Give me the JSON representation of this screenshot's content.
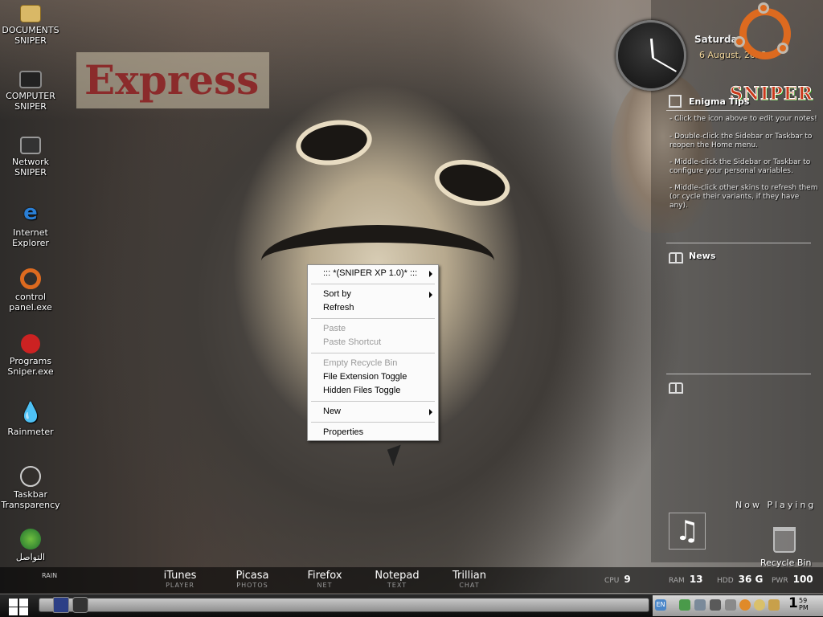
{
  "desktop_icons": [
    {
      "label": "DOCUMENTS SNIPER",
      "icon": "folder-icon"
    },
    {
      "label": "COMPUTER SNIPER",
      "icon": "computer-icon"
    },
    {
      "label": "Network SNIPER",
      "icon": "network-icon"
    },
    {
      "label": "Internet Explorer",
      "icon": "internet-explorer-icon"
    },
    {
      "label": "control panel.exe",
      "icon": "ubuntu-icon"
    },
    {
      "label": "Programs Sniper.exe",
      "icon": "programs-icon"
    },
    {
      "label": "Rainmeter",
      "icon": "rainmeter-icon"
    },
    {
      "label": "Taskbar Transparency",
      "icon": "taskbar-transparency-icon"
    },
    {
      "label": "التواصل",
      "icon": "globe-icon"
    }
  ],
  "background": {
    "sign_text": "Express"
  },
  "context_menu": {
    "header": "::: *(SNIPER XP 1.0)* :::",
    "sort_by": "Sort  by",
    "refresh": "Refresh",
    "paste": "Paste",
    "paste_shortcut": "Paste Shortcut",
    "empty_recycle_bin": "Empty Recycle Bin",
    "file_extension_toggle": "File Extension Toggle",
    "hidden_files_toggle": "Hidden Files Toggle",
    "new": "New",
    "properties": "Properties"
  },
  "sidebar": {
    "day": "Saturday",
    "date": "6 August, 2022",
    "brand": "SNIPER",
    "tips_title": "Enigma Tips",
    "tips": [
      "- Click the icon above to edit your notes!",
      "- Double-click the Sidebar or Taskbar to reopen the Home menu.",
      "- Middle-click the Sidebar or Taskbar to configure your personal variables.",
      "- Middle-click other skins to refresh them (or cycle their variants, if they have any)."
    ],
    "news_title": "News",
    "now_playing": "Now Playing",
    "recycle_bin": "Recycle Bin"
  },
  "launch_bar": {
    "rain": "RAIN",
    "items": [
      {
        "name": "iTunes",
        "sub": "PLAYER"
      },
      {
        "name": "Picasa",
        "sub": "PHOTOS"
      },
      {
        "name": "Firefox",
        "sub": "NET"
      },
      {
        "name": "Notepad",
        "sub": "TEXT"
      },
      {
        "name": "Trillian",
        "sub": "CHAT"
      }
    ],
    "stats": {
      "cpu_label": "CPU",
      "cpu": "9",
      "ram_label": "RAM",
      "ram": "13",
      "hdd_label": "HDD",
      "hdd": "36 G",
      "pwr_label": "PWR",
      "pwr": "100"
    }
  },
  "taskbar": {
    "language": "EN",
    "time": "1",
    "minutes": "59",
    "ampm": "PM"
  },
  "colors": {
    "ubuntu_orange": "#dd6a1f",
    "menu_bg": "#fbfbfb"
  }
}
